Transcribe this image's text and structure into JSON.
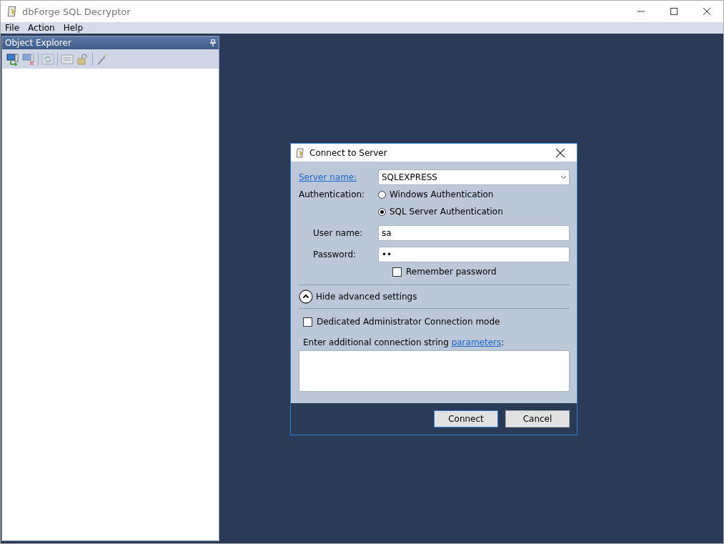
{
  "window": {
    "title": "dbForge SQL Decryptor"
  },
  "menu": [
    "File",
    "Action",
    "Help"
  ],
  "object_explorer": {
    "title": "Object Explorer"
  },
  "dialog": {
    "title": "Connect to Server",
    "server": {
      "label": "Server name:",
      "value": "SQLEXPRESS"
    },
    "authentication": {
      "label": "Authentication:",
      "options": [
        {
          "label": "Windows Authentication",
          "selected": false
        },
        {
          "label": "SQL Server Authentication",
          "selected": true
        }
      ]
    },
    "user": {
      "label": "User name:",
      "value": "sa"
    },
    "password": {
      "label": "Password:",
      "value": "••"
    },
    "remember": {
      "label": "Remember password",
      "checked": false
    },
    "advanced_toggle": "Hide advanced settings",
    "dac": {
      "label": "Dedicated Administrator Connection mode",
      "checked": false
    },
    "parameters": {
      "prefix": "Enter additional connection string ",
      "link": "parameters",
      "suffix": ":"
    },
    "buttons": [
      {
        "label": "Connect",
        "default": true
      },
      {
        "label": "Cancel",
        "default": false
      }
    ]
  }
}
